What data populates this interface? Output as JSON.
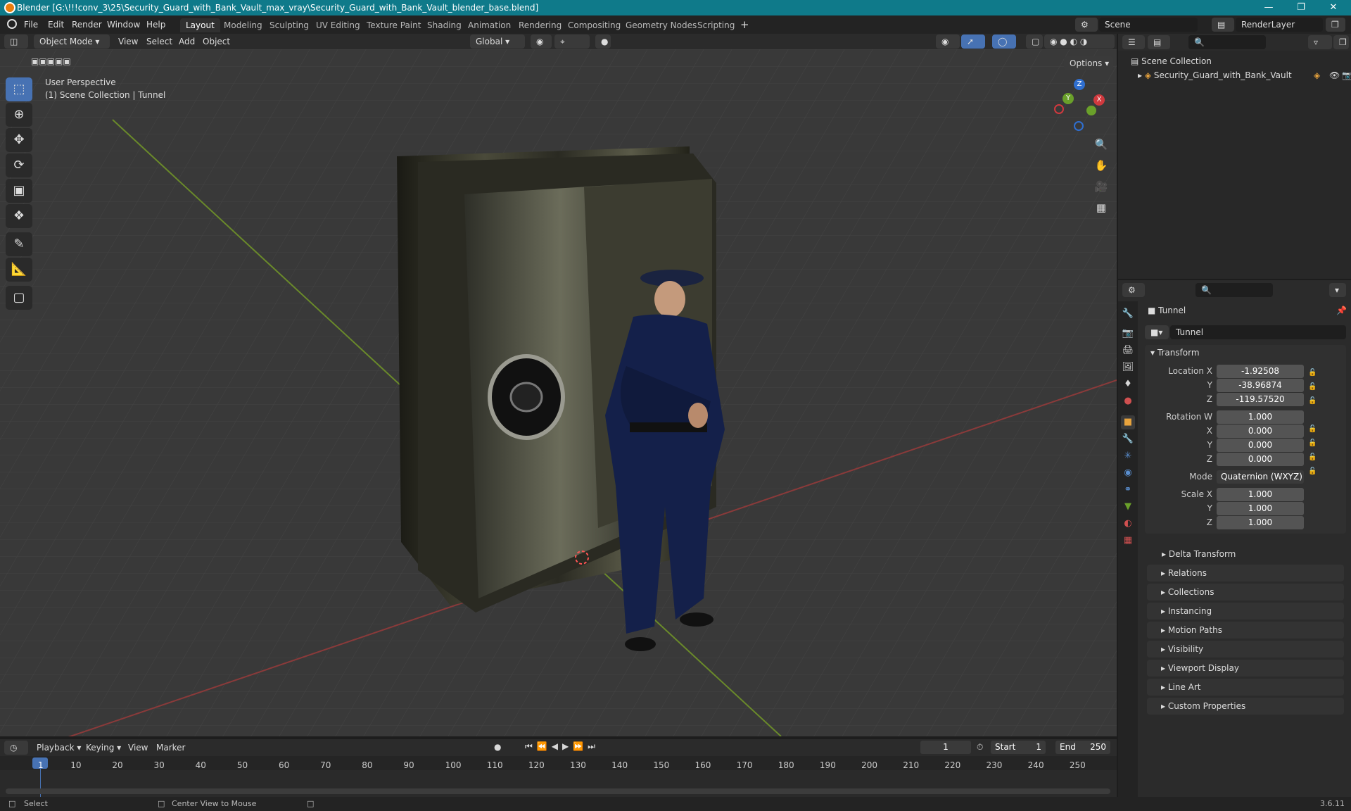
{
  "window": {
    "title": "Blender [G:\\!!!conv_3\\25\\Security_Guard_with_Bank_Vault_max_vray\\Security_Guard_with_Bank_Vault_blender_base.blend]"
  },
  "menu": {
    "items": [
      "File",
      "Edit",
      "Render",
      "Window",
      "Help"
    ]
  },
  "workspaces": [
    "Layout",
    "Modeling",
    "Sculpting",
    "UV Editing",
    "Texture Paint",
    "Shading",
    "Animation",
    "Rendering",
    "Compositing",
    "Geometry Nodes",
    "Scripting"
  ],
  "scene": {
    "name": "Scene",
    "view_layer": "RenderLayer"
  },
  "viewport_header": {
    "mode": "Object Mode",
    "menus": [
      "View",
      "Select",
      "Add",
      "Object"
    ],
    "orientation": "Global",
    "options_label": "Options"
  },
  "viewport": {
    "perspective_label": "User Perspective",
    "collection_label": "(1) Scene Collection | Tunnel"
  },
  "outliner": {
    "root": "Scene Collection",
    "items": [
      "Security_Guard_with_Bank_Vault"
    ]
  },
  "properties": {
    "object_name": "Tunnel",
    "data_name": "Tunnel",
    "transform_label": "Transform",
    "location_label": "Location X",
    "location": {
      "x": "-1.92508",
      "y": "-38.96874",
      "z": "-119.57520"
    },
    "rotation_label": "Rotation W",
    "rotation": {
      "w": "1.000",
      "x": "0.000",
      "y": "0.000",
      "z": "0.000"
    },
    "mode_label": "Mode",
    "mode": "Quaternion (WXYZ)",
    "scale_label": "Scale X",
    "scale": {
      "x": "1.000",
      "y": "1.000",
      "z": "1.000"
    },
    "axis_y": "Y",
    "axis_z": "Z",
    "axis_x": "X",
    "delta": "Delta Transform",
    "panels": [
      "Relations",
      "Collections",
      "Instancing",
      "Motion Paths",
      "Visibility",
      "Viewport Display",
      "Line Art",
      "Custom Properties"
    ]
  },
  "timeline": {
    "menus": [
      "Playback",
      "Keying",
      "View",
      "Marker"
    ],
    "current_frame": "1",
    "start_label": "Start",
    "start": "1",
    "end_label": "End",
    "end": "250",
    "ticks": [
      "1",
      "10",
      "20",
      "30",
      "40",
      "50",
      "60",
      "70",
      "80",
      "90",
      "100",
      "110",
      "120",
      "130",
      "140",
      "150",
      "160",
      "170",
      "180",
      "190",
      "200",
      "210",
      "220",
      "230",
      "240",
      "250"
    ]
  },
  "status": {
    "left": "Select",
    "middle": "Center View to Mouse",
    "version": "3.6.11"
  },
  "gizmo": {
    "x": "X",
    "y": "Y",
    "z": "Z"
  }
}
